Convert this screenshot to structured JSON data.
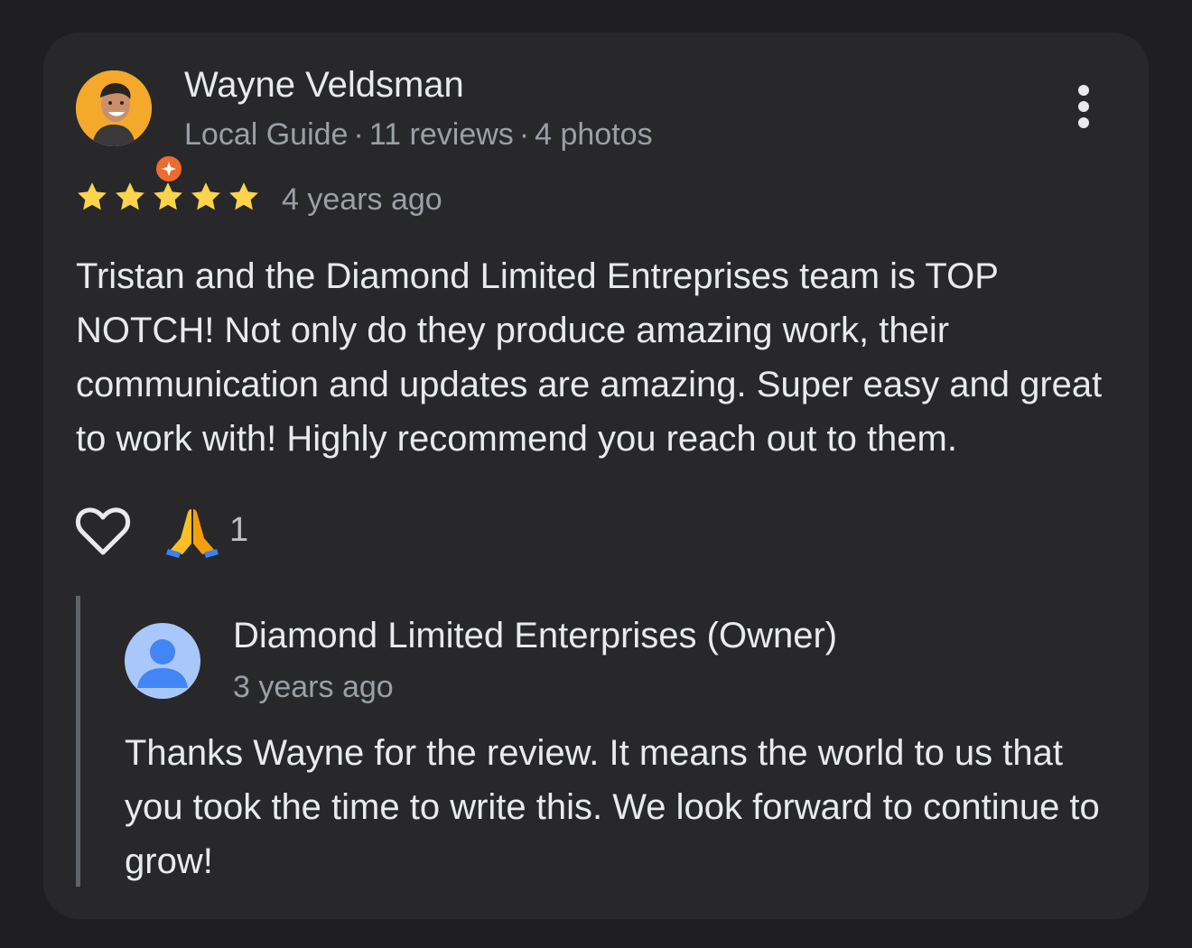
{
  "review": {
    "reviewer_name": "Wayne Veldsman",
    "badge": "Local Guide",
    "review_count": "11 reviews",
    "photo_count": "4 photos",
    "separator": "·",
    "rating": 5,
    "max_rating": 5,
    "time": "4 years ago",
    "text": "Tristan and the Diamond Limited Entreprises team is TOP NOTCH! Not only do they produce amazing work, their communication and updates are amazing. Super easy and great to work with! Highly recommend you reach out to them.",
    "reaction_emoji": "🙏",
    "reaction_count": "1",
    "icons": {
      "avatar": "reviewer-avatar",
      "badge": "local-guide-badge-icon",
      "more": "more-vertical-icon",
      "like": "heart-icon",
      "star": "star-icon"
    }
  },
  "owner_reply": {
    "name": "Diamond Limited Enterprises (Owner)",
    "time": "3 years ago",
    "text": "Thanks Wayne for the review. It means the world to us that you took the time to write this. We look forward to continue to grow!",
    "icon": "default-person-avatar-icon"
  },
  "colors": {
    "background": "#1f1f21",
    "card": "#28282b",
    "primary_text": "#e8eaed",
    "secondary_text": "#9aa0a6",
    "star": "#fcd34d",
    "badge": "#ee6b2f",
    "owner_avatar": "#a8c7fa",
    "owner_avatar_figure": "#4285f4"
  }
}
